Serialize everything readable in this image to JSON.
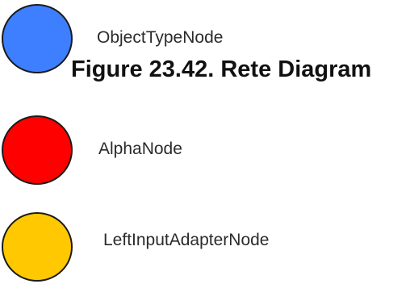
{
  "caption": "Figure 23.42. Rete Diagram",
  "nodes": [
    {
      "label": "ObjectTypeNode",
      "fill": "#3d7fff",
      "stroke": "#1a1a1a"
    },
    {
      "label": "AlphaNode",
      "fill": "#ff0000",
      "stroke": "#1a1a1a"
    },
    {
      "label": "LeftInputAdapterNode",
      "fill": "#ffc800",
      "stroke": "#1a1a1a"
    }
  ]
}
